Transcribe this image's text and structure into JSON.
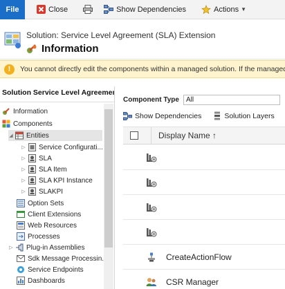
{
  "ribbon": {
    "file_label": "File",
    "close_label": "Close",
    "show_dependencies_label": "Show Dependencies",
    "actions_label": "Actions",
    "accent": "#1a6ec8"
  },
  "header": {
    "solution_line": "Solution: Service Level Agreement (SLA) Extension",
    "title": "Information"
  },
  "warning": {
    "text": "You cannot directly edit the components within a managed solution. If the managed pro"
  },
  "nav": {
    "title": "Solution Service Level Agreement...",
    "items": [
      {
        "label": "Information",
        "icon": "info-icon"
      },
      {
        "label": "Components",
        "icon": "components-icon"
      },
      {
        "label": "Entities",
        "icon": "entities-icon"
      },
      {
        "label": "Service Configurati...",
        "icon": "entity-icon"
      },
      {
        "label": "SLA",
        "icon": "entity-icon"
      },
      {
        "label": "SLA Item",
        "icon": "entity-icon"
      },
      {
        "label": "SLA KPI Instance",
        "icon": "entity-icon"
      },
      {
        "label": "SLAKPI",
        "icon": "entity-icon"
      },
      {
        "label": "Option Sets",
        "icon": "option-sets-icon"
      },
      {
        "label": "Client Extensions",
        "icon": "client-extensions-icon"
      },
      {
        "label": "Web Resources",
        "icon": "web-resources-icon"
      },
      {
        "label": "Processes",
        "icon": "processes-icon"
      },
      {
        "label": "Plug-in Assemblies",
        "icon": "plugin-icon"
      },
      {
        "label": "Sdk Message Processin...",
        "icon": "sdk-message-icon"
      },
      {
        "label": "Service Endpoints",
        "icon": "service-endpoints-icon"
      },
      {
        "label": "Dashboards",
        "icon": "dashboards-icon"
      }
    ]
  },
  "pane": {
    "component_type_label": "Component Type",
    "component_type_value": "All",
    "show_dependencies_label": "Show Dependencies",
    "solution_layers_label": "Solution Layers",
    "column_display_name": "Display Name ↑",
    "rows": [
      {
        "name": "",
        "icon": "flow-icon"
      },
      {
        "name": "",
        "icon": "flow-icon"
      },
      {
        "name": "",
        "icon": "flow-icon"
      },
      {
        "name": "",
        "icon": "flow-icon"
      },
      {
        "name": "CreateActionFlow",
        "icon": "action-flow-icon"
      },
      {
        "name": "CSR Manager",
        "icon": "security-role-icon"
      }
    ]
  }
}
